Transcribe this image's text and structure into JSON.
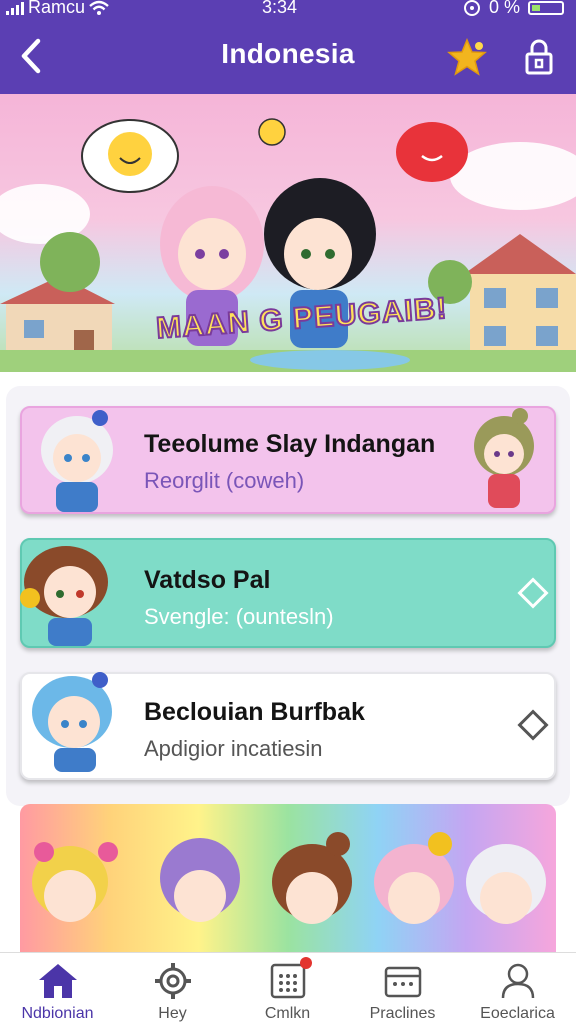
{
  "status_bar": {
    "carrier": "Ramcu",
    "time": "3:34",
    "battery": "0 %"
  },
  "header": {
    "title": "Indonesia",
    "back_icon": "chevron-left-icon",
    "favorite_icon": "star-icon",
    "lock_icon": "lock-icon"
  },
  "colors": {
    "header_bg": "#5b3fb3",
    "active_tab": "#4b35a8",
    "card1_bg": "#f3c3ec",
    "card2_bg": "#7fdcc8",
    "star": "#f2b51f"
  },
  "banner": {
    "title": "MAAN G PEUGAIB!"
  },
  "list": [
    {
      "title": "Teeolume Slay Indangan",
      "subtitle": "Reorglit (coweh)"
    },
    {
      "title": "Vatdso Pal",
      "subtitle": "Svengle: (ountesln)",
      "chevron_icon": "diamond-chevron-icon"
    },
    {
      "title": "Beclouian Burfbak",
      "subtitle": "Apdigior incatiesin",
      "chevron_icon": "diamond-chevron-icon"
    }
  ],
  "tabs": [
    {
      "label": "Ndbionian",
      "icon": "home-icon",
      "active": true
    },
    {
      "label": "Hey",
      "icon": "gear-icon"
    },
    {
      "label": "Cmlkn",
      "icon": "keypad-icon",
      "badge": true
    },
    {
      "label": "Praclines",
      "icon": "calendar-icon"
    },
    {
      "label": "Eoeclarica",
      "icon": "user-icon"
    }
  ]
}
